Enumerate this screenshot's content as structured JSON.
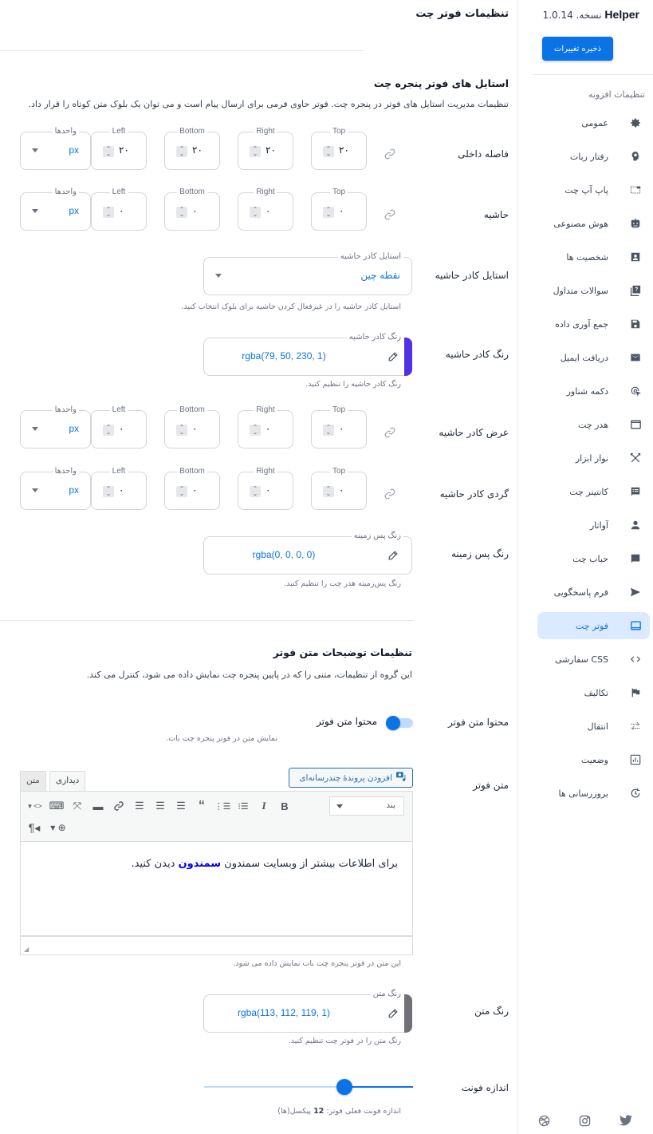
{
  "sidebar": {
    "brand_name": "Helper",
    "version_label": "نسخه. 1.0.14",
    "save_button": "ذخیره تغییرات",
    "section_label": "تنظیمات افزونه",
    "items": [
      {
        "label": "عمومی",
        "icon": "gear-icon"
      },
      {
        "label": "رفتار ربات",
        "icon": "brain-icon"
      },
      {
        "label": "پاپ آپ چت",
        "icon": "popup-icon"
      },
      {
        "label": "هوش مصنوعی",
        "icon": "robot-icon"
      },
      {
        "label": "شخصیت ها",
        "icon": "person-card-icon"
      },
      {
        "label": "سوالات متداول",
        "icon": "faq-icon"
      },
      {
        "label": "جمع آوری داده",
        "icon": "floppy-disk-icon"
      },
      {
        "label": "دریافت ایمیل",
        "icon": "envelope-icon"
      },
      {
        "label": "دکمه شناور",
        "icon": "cursor-click-icon"
      },
      {
        "label": "هدر چت",
        "icon": "window-icon"
      },
      {
        "label": "نوار ابزار",
        "icon": "tools-icon"
      },
      {
        "label": "کانتینر چت",
        "icon": "chat-container-icon"
      },
      {
        "label": "آواتار",
        "icon": "user-icon"
      },
      {
        "label": "حباب چت",
        "icon": "chat-bubble-icon"
      },
      {
        "label": "فرم پاسخگویی",
        "icon": "send-icon"
      },
      {
        "label": "فوتر چت",
        "icon": "footer-icon",
        "active": true
      },
      {
        "label": "CSS سفارشی",
        "icon": "code-icon"
      },
      {
        "label": "تکالیف",
        "icon": "flag-icon"
      },
      {
        "label": "انتقال",
        "icon": "transfer-icon"
      },
      {
        "label": "وضعیت",
        "icon": "chart-icon"
      },
      {
        "label": "بروزرسانی ها",
        "icon": "update-icon"
      }
    ],
    "social": [
      "dribbble-icon",
      "instagram-icon",
      "twitter-icon"
    ]
  },
  "main": {
    "page_title": "تنظیمات فوتر چت",
    "styles_section": {
      "title": "استایل های فوتر پنجره چت",
      "description": "تنظیمات مدیریت استایل های فوتر در پنجره چت. فوتر حاوی فرمی برای ارسال پیام است و می توان یک بلوک متن کوتاه را قرار داد."
    },
    "spacing_rows": [
      {
        "label": "فاصله داخلی",
        "top": "۲۰",
        "right": "۲۰",
        "bottom": "۲۰",
        "left": "۲۰",
        "unit": "px"
      },
      {
        "label": "حاشیه",
        "top": "۰",
        "right": "۰",
        "bottom": "۰",
        "left": "۰",
        "unit": "px"
      },
      {
        "label": "عرض کادر حاشیه",
        "top": "۰",
        "right": "۰",
        "bottom": "۰",
        "left": "۰",
        "unit": "px"
      },
      {
        "label": "گردی کادر حاشیه",
        "top": "۰",
        "right": "۰",
        "bottom": "۰",
        "left": "۰",
        "unit": "px"
      }
    ],
    "side_labels": {
      "top": "Top",
      "right": "Right",
      "bottom": "Bottom",
      "left": "Left",
      "units": "واحدها"
    },
    "border_style": {
      "label": "استایل کادر حاشیه",
      "legend": "استایل کادر حاشیه",
      "value": "نقطه چین",
      "help": "استایل کادر حاشیه را در غیرفعال کردن حاشیه برای بلوک انتخاب کنید."
    },
    "border_color": {
      "label": "رنگ کادر حاشیه",
      "legend": "رنگ کادر حاشیه",
      "value": "rgba(79, 50, 230, 1)",
      "swatch": "#4f32e6",
      "help": "رنگ کادر حاشیه را تنظیم کنید."
    },
    "bg_color": {
      "label": "رنگ پس زمینه",
      "legend": "رنگ پس زمینه",
      "value": "rgba(0, 0, 0, 0)",
      "help": "رنگ پس‌زمینه هدر چت را تنظیم کنید."
    },
    "text_section": {
      "title": "تنظیمات توضیحات متن فوتر",
      "description": "این گروه از تنظیمات، متنی را که در پایین پنجره چت نمایش داده می شود، کنترل می کند."
    },
    "footer_toggle": {
      "label": "محتوا متن فوتر",
      "toggle_label": "محتوا متن فوتر",
      "checked": true,
      "help": "نمایش متن در فوتر پنجره چت بات."
    },
    "footer_text": {
      "label": "متن فوتر",
      "add_media": "افزودن پروندهٔ چندرسانه‌ای",
      "tab_visual": "دیداری",
      "tab_text": "متن",
      "format_select": "بند",
      "content_before": "برای اطلاعات بیشتر از وبسایت سمندون ",
      "content_link": "سمندون",
      "content_after": " دیدن کنید.",
      "help": "این متن در فوتر پنجره چت بات نمایش داده می شود."
    },
    "text_color": {
      "label": "رنگ متن",
      "legend": "رنگ متن",
      "value": "rgba(113, 112, 119, 1)",
      "swatch": "#717077",
      "help": "رنگ متن را در فوتر چت تنظیم کنید."
    },
    "font_size": {
      "label": "اندازه فونت",
      "slider_fraction": 0.33,
      "help_prefix": "اندازه فونت فعلی فوتر: ",
      "value": "12",
      "help_suffix": " پیکسل(ها)"
    }
  },
  "colors": {
    "accent": "#0a74e6",
    "active_bg": "#dbeafe"
  }
}
